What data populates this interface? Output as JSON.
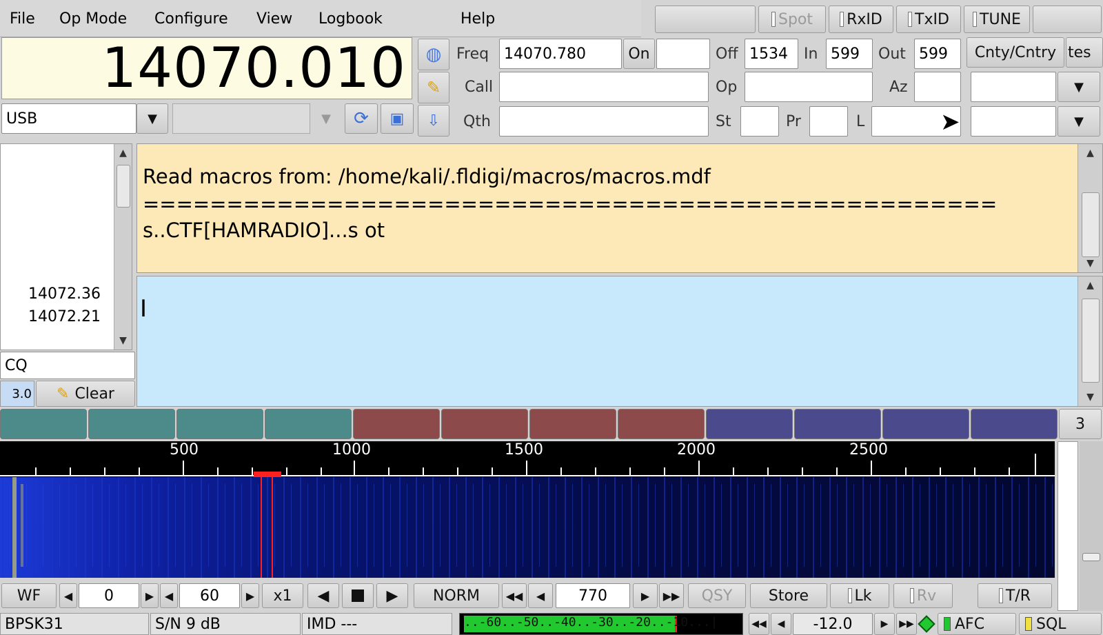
{
  "menu": {
    "file": "File",
    "opmode": "Op Mode",
    "configure": "Configure",
    "view": "View",
    "logbook": "Logbook",
    "help": "Help"
  },
  "top_buttons": {
    "spot": "Spot",
    "rxid": "RxID",
    "txid": "TxID",
    "tune": "TUNE"
  },
  "frequency_display": "14070.010",
  "mode_select": "USB",
  "log": {
    "freq_label": "Freq",
    "freq_value": "14070.780",
    "on_label": "On",
    "on_value": "",
    "off_label": "Off",
    "off_value": "1534",
    "in_label": "In",
    "in_value": "599",
    "out_label": "Out",
    "out_value": "599",
    "cnty_label": "Cnty/Cntry",
    "notes_label": "tes",
    "call_label": "Call",
    "call_value": "",
    "op_label": "Op",
    "op_value": "",
    "az_label": "Az",
    "az_value": "",
    "qth_label": "Qth",
    "qth_value": "",
    "st_label": "St",
    "st_value": "",
    "pr_label": "Pr",
    "pr_value": "",
    "l_label": "L",
    "l_value": ""
  },
  "signal_browser": {
    "items": [
      "14072.36",
      "14072.21"
    ],
    "search_value": "CQ",
    "squelch_value": "3.0",
    "clear_label": "Clear"
  },
  "rx_text": {
    "line1": "Read macros from: /home/kali/.fldigi/macros/macros.mdf",
    "line2": "===================================================",
    "line3": "s..CTF[HAMRADIO]...s ot"
  },
  "macro_set_number": "3",
  "waterfall": {
    "scale_labels": [
      "500",
      "1000",
      "1500",
      "2000",
      "2500"
    ],
    "colors": {
      "background": "#000000",
      "signal_low": "#0a1a7a",
      "signal_high": "#2a4cff",
      "cursor": "#ff2020"
    }
  },
  "controls": {
    "wf_label": "WF",
    "ref_value": "0",
    "range_value": "60",
    "zoom_label": "x1",
    "norm_label": "NORM",
    "cursor_freq": "770",
    "qsy_label": "QSY",
    "store_label": "Store",
    "lk_label": "Lk",
    "rv_label": "Rv",
    "tr_label": "T/R"
  },
  "status": {
    "mode": "BPSK31",
    "snr": "S/N  9 dB",
    "imd": "IMD ---",
    "meter_scale": "..-60..-50..-40..-30..-20..-10...|",
    "power_value": "-12.0",
    "afc_label": "AFC",
    "sql_label": "SQL"
  }
}
